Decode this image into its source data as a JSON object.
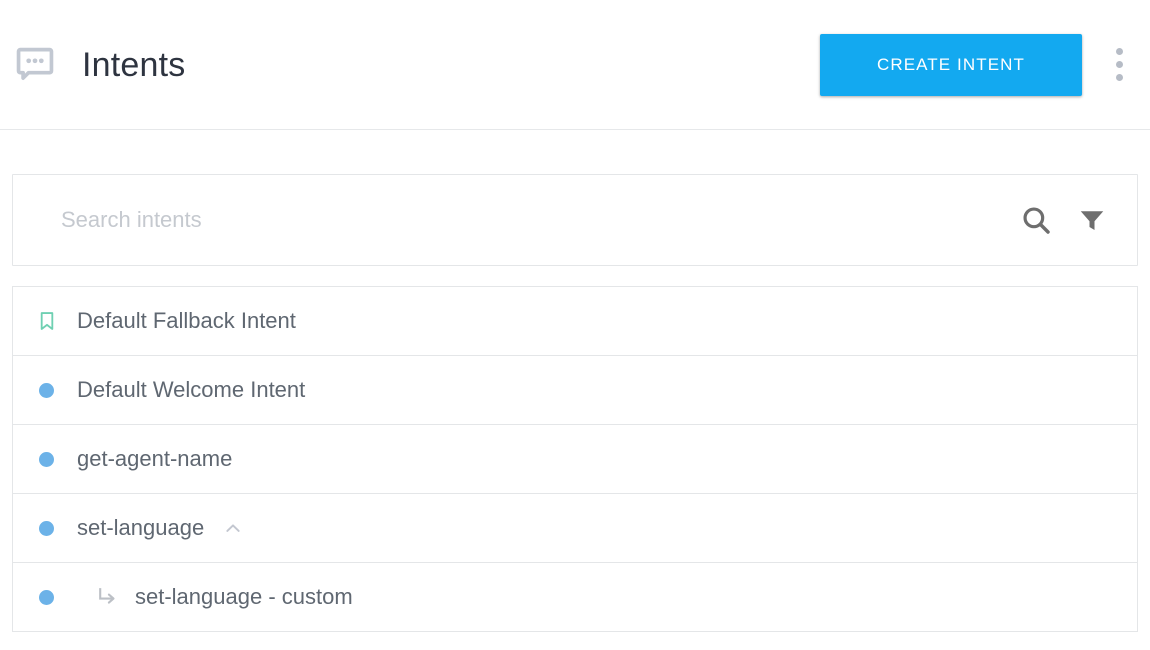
{
  "header": {
    "icon": "chat-bubble-dots-icon",
    "title": "Intents",
    "create_button_label": "CREATE INTENT",
    "overflow_menu": "more-vert-icon",
    "accent_color": "#13a9f0",
    "title_color": "#2e3440",
    "icon_color": "#c2c8d2"
  },
  "search": {
    "placeholder": "Search intents",
    "value": "",
    "search_icon": "search-icon",
    "filter_icon": "filter-funnel-icon",
    "icon_color": "#6e6e6e",
    "placeholder_color": "#c5c9cf"
  },
  "intents": [
    {
      "label": "Default Fallback Intent",
      "marker": "bookmark-outline-icon",
      "marker_color": "#6fd0b2",
      "child": false,
      "expander": null
    },
    {
      "label": "Default Welcome Intent",
      "marker": "blue-dot-icon",
      "marker_color": "#6cb2e8",
      "child": false,
      "expander": null
    },
    {
      "label": "get-agent-name",
      "marker": "blue-dot-icon",
      "marker_color": "#6cb2e8",
      "child": false,
      "expander": null
    },
    {
      "label": "set-language",
      "marker": "blue-dot-icon",
      "marker_color": "#6cb2e8",
      "child": false,
      "expander": "chevron-up-icon"
    },
    {
      "label": "set-language - custom",
      "marker": "blue-dot-icon",
      "marker_color": "#6cb2e8",
      "child": true,
      "child_icon": "subdirectory-arrow-right-icon",
      "expander": null
    }
  ]
}
